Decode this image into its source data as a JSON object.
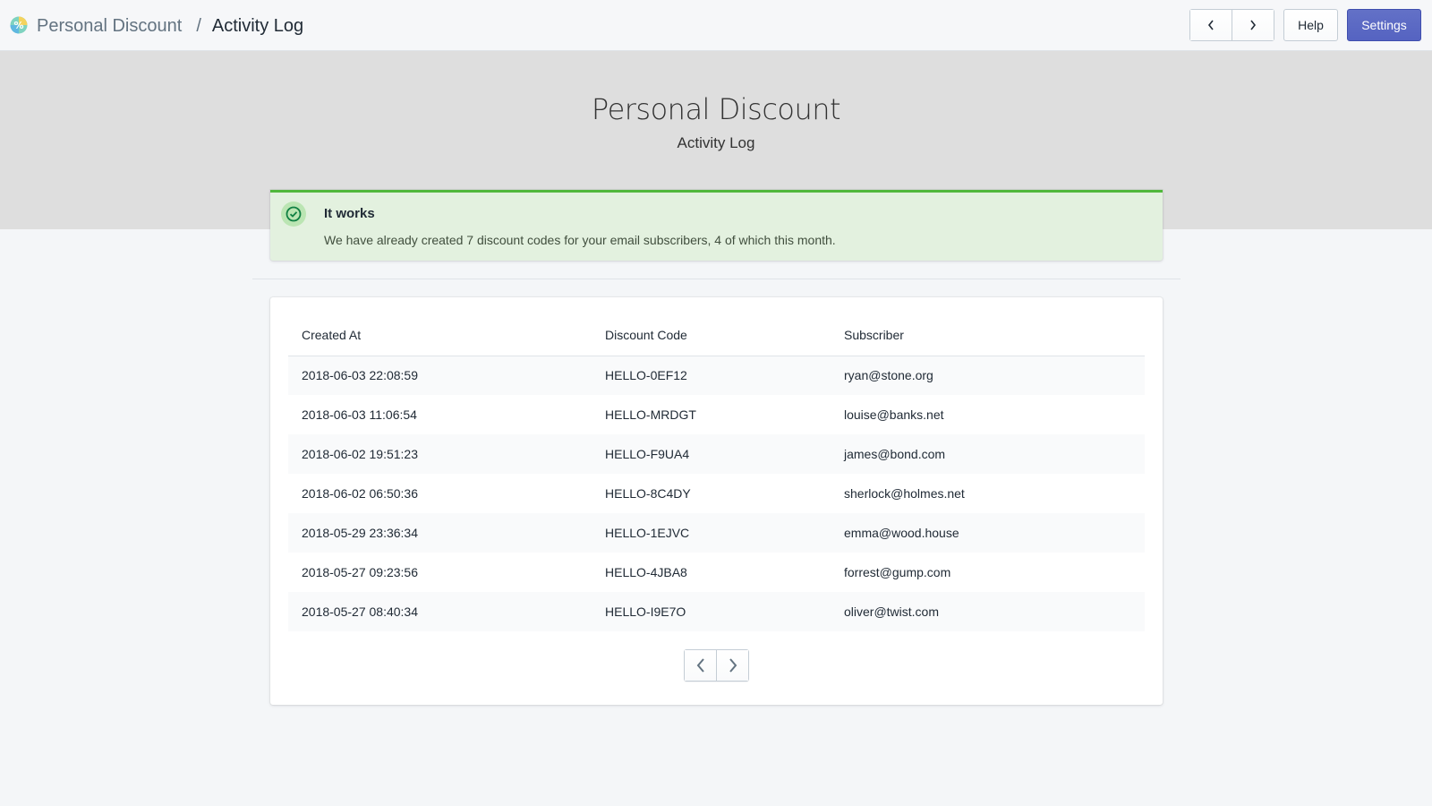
{
  "header": {
    "app_name": "Personal Discount",
    "separator": "/",
    "page_name": "Activity Log",
    "help_label": "Help",
    "settings_label": "Settings"
  },
  "hero": {
    "title": "Personal Discount",
    "subtitle": "Activity Log"
  },
  "banner": {
    "title": "It works",
    "text": "We have already created 7 discount codes for your email subscribers, 4 of which this month."
  },
  "table": {
    "columns": [
      "Created At",
      "Discount Code",
      "Subscriber"
    ],
    "rows": [
      [
        "2018-06-03 22:08:59",
        "HELLO-0EF12",
        "ryan@stone.org"
      ],
      [
        "2018-06-03 11:06:54",
        "HELLO-MRDGT",
        "louise@banks.net"
      ],
      [
        "2018-06-02 19:51:23",
        "HELLO-F9UA4",
        "james@bond.com"
      ],
      [
        "2018-06-02 06:50:36",
        "HELLO-8C4DY",
        "sherlock@holmes.net"
      ],
      [
        "2018-05-29 23:36:34",
        "HELLO-1EJVC",
        "emma@wood.house"
      ],
      [
        "2018-05-27 09:23:56",
        "HELLO-4JBA8",
        "forrest@gump.com"
      ],
      [
        "2018-05-27 08:40:34",
        "HELLO-I9E7O",
        "oliver@twist.com"
      ]
    ]
  },
  "icons": {
    "logo": "app-logo-icon",
    "prev": "chevron-left-icon",
    "next": "chevron-right-icon",
    "success": "check-circle-icon"
  },
  "colors": {
    "primary": "#5c6ac4",
    "success": "#50b83c",
    "banner_bg": "#e3f1df",
    "hero_bg": "#dedede"
  }
}
